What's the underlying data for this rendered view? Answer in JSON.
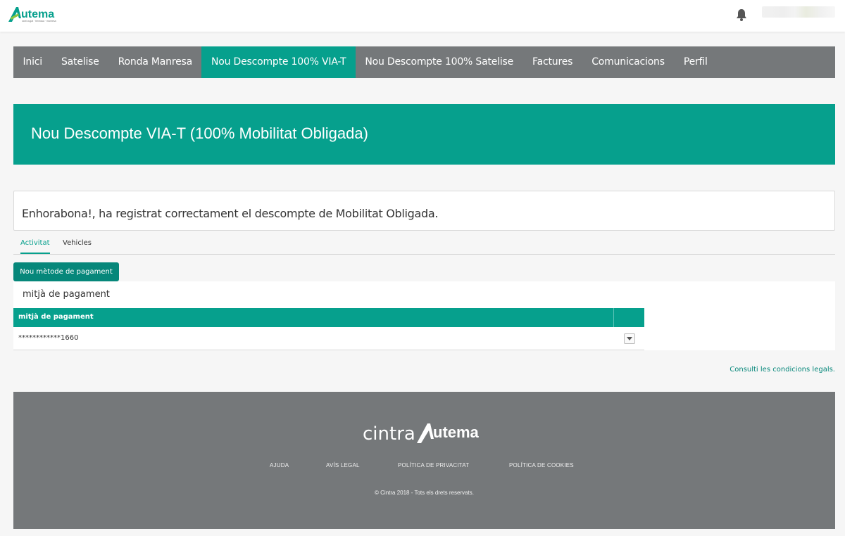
{
  "header": {
    "logo_text": "utema",
    "logo_subtext": "sant cugat · terrassa · manresa",
    "notifications_icon": "bell-icon"
  },
  "nav": {
    "items": [
      {
        "label": "Inici",
        "active": false
      },
      {
        "label": "Satelise",
        "active": false
      },
      {
        "label": "Ronda Manresa",
        "active": false
      },
      {
        "label": "Nou Descompte 100% VIA-T",
        "active": true
      },
      {
        "label": "Nou Descompte 100% Satelise",
        "active": false
      },
      {
        "label": "Factures",
        "active": false
      },
      {
        "label": "Comunicacions",
        "active": false
      },
      {
        "label": "Perfil",
        "active": false
      }
    ]
  },
  "banner": {
    "title": "Nou Descompte VIA-T (100% Mobilitat Obligada)"
  },
  "message": {
    "text": "Enhorabona!, ha registrat correctament el descompte de Mobilitat Obligada."
  },
  "tabs": {
    "activitat": "Activitat",
    "vehicles": "Vehicles"
  },
  "actions": {
    "new_payment_method": "Nou mètode de pagament"
  },
  "panel": {
    "title": "mitjà de pagament",
    "table": {
      "columns": [
        "mitjà de pagament"
      ],
      "rows": [
        {
          "value": "************1660"
        }
      ]
    }
  },
  "legal_link": "Consulti les condicions legals.",
  "footer": {
    "brand_left": "cintra",
    "brand_right": "utema",
    "links": [
      "AJUDA",
      "AVÍS LEGAL",
      "POLÍTICA DE PRIVACITAT",
      "POLÍTICA DE COOKIES"
    ],
    "copyright": "© Cintra 2018 - Tots els drets reservats."
  },
  "colors": {
    "brand_teal": "#06a08d",
    "nav_gray": "#75787a",
    "button_teal": "#06877a"
  }
}
